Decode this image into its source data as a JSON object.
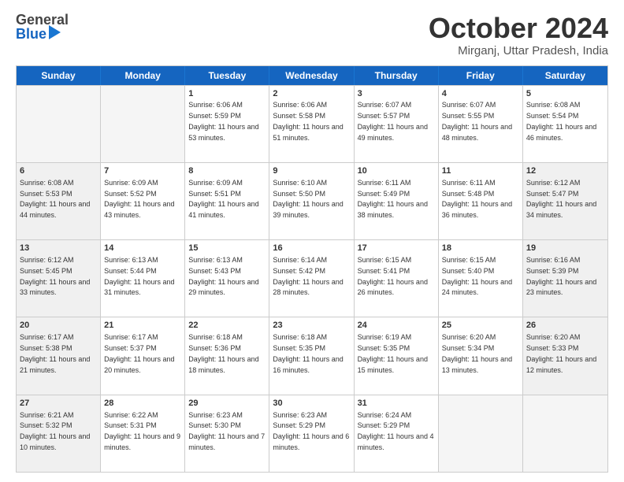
{
  "header": {
    "logo_general": "General",
    "logo_blue": "Blue",
    "title": "October 2024",
    "location": "Mirganj, Uttar Pradesh, India"
  },
  "days_of_week": [
    "Sunday",
    "Monday",
    "Tuesday",
    "Wednesday",
    "Thursday",
    "Friday",
    "Saturday"
  ],
  "weeks": [
    [
      {
        "day": "",
        "sunrise": "",
        "sunset": "",
        "daylight": "",
        "shaded": true
      },
      {
        "day": "",
        "sunrise": "",
        "sunset": "",
        "daylight": "",
        "shaded": true
      },
      {
        "day": "1",
        "sunrise": "Sunrise: 6:06 AM",
        "sunset": "Sunset: 5:59 PM",
        "daylight": "Daylight: 11 hours and 53 minutes.",
        "shaded": false
      },
      {
        "day": "2",
        "sunrise": "Sunrise: 6:06 AM",
        "sunset": "Sunset: 5:58 PM",
        "daylight": "Daylight: 11 hours and 51 minutes.",
        "shaded": false
      },
      {
        "day": "3",
        "sunrise": "Sunrise: 6:07 AM",
        "sunset": "Sunset: 5:57 PM",
        "daylight": "Daylight: 11 hours and 49 minutes.",
        "shaded": false
      },
      {
        "day": "4",
        "sunrise": "Sunrise: 6:07 AM",
        "sunset": "Sunset: 5:55 PM",
        "daylight": "Daylight: 11 hours and 48 minutes.",
        "shaded": false
      },
      {
        "day": "5",
        "sunrise": "Sunrise: 6:08 AM",
        "sunset": "Sunset: 5:54 PM",
        "daylight": "Daylight: 11 hours and 46 minutes.",
        "shaded": false
      }
    ],
    [
      {
        "day": "6",
        "sunrise": "Sunrise: 6:08 AM",
        "sunset": "Sunset: 5:53 PM",
        "daylight": "Daylight: 11 hours and 44 minutes.",
        "shaded": true
      },
      {
        "day": "7",
        "sunrise": "Sunrise: 6:09 AM",
        "sunset": "Sunset: 5:52 PM",
        "daylight": "Daylight: 11 hours and 43 minutes.",
        "shaded": false
      },
      {
        "day": "8",
        "sunrise": "Sunrise: 6:09 AM",
        "sunset": "Sunset: 5:51 PM",
        "daylight": "Daylight: 11 hours and 41 minutes.",
        "shaded": false
      },
      {
        "day": "9",
        "sunrise": "Sunrise: 6:10 AM",
        "sunset": "Sunset: 5:50 PM",
        "daylight": "Daylight: 11 hours and 39 minutes.",
        "shaded": false
      },
      {
        "day": "10",
        "sunrise": "Sunrise: 6:11 AM",
        "sunset": "Sunset: 5:49 PM",
        "daylight": "Daylight: 11 hours and 38 minutes.",
        "shaded": false
      },
      {
        "day": "11",
        "sunrise": "Sunrise: 6:11 AM",
        "sunset": "Sunset: 5:48 PM",
        "daylight": "Daylight: 11 hours and 36 minutes.",
        "shaded": false
      },
      {
        "day": "12",
        "sunrise": "Sunrise: 6:12 AM",
        "sunset": "Sunset: 5:47 PM",
        "daylight": "Daylight: 11 hours and 34 minutes.",
        "shaded": true
      }
    ],
    [
      {
        "day": "13",
        "sunrise": "Sunrise: 6:12 AM",
        "sunset": "Sunset: 5:45 PM",
        "daylight": "Daylight: 11 hours and 33 minutes.",
        "shaded": true
      },
      {
        "day": "14",
        "sunrise": "Sunrise: 6:13 AM",
        "sunset": "Sunset: 5:44 PM",
        "daylight": "Daylight: 11 hours and 31 minutes.",
        "shaded": false
      },
      {
        "day": "15",
        "sunrise": "Sunrise: 6:13 AM",
        "sunset": "Sunset: 5:43 PM",
        "daylight": "Daylight: 11 hours and 29 minutes.",
        "shaded": false
      },
      {
        "day": "16",
        "sunrise": "Sunrise: 6:14 AM",
        "sunset": "Sunset: 5:42 PM",
        "daylight": "Daylight: 11 hours and 28 minutes.",
        "shaded": false
      },
      {
        "day": "17",
        "sunrise": "Sunrise: 6:15 AM",
        "sunset": "Sunset: 5:41 PM",
        "daylight": "Daylight: 11 hours and 26 minutes.",
        "shaded": false
      },
      {
        "day": "18",
        "sunrise": "Sunrise: 6:15 AM",
        "sunset": "Sunset: 5:40 PM",
        "daylight": "Daylight: 11 hours and 24 minutes.",
        "shaded": false
      },
      {
        "day": "19",
        "sunrise": "Sunrise: 6:16 AM",
        "sunset": "Sunset: 5:39 PM",
        "daylight": "Daylight: 11 hours and 23 minutes.",
        "shaded": true
      }
    ],
    [
      {
        "day": "20",
        "sunrise": "Sunrise: 6:17 AM",
        "sunset": "Sunset: 5:38 PM",
        "daylight": "Daylight: 11 hours and 21 minutes.",
        "shaded": true
      },
      {
        "day": "21",
        "sunrise": "Sunrise: 6:17 AM",
        "sunset": "Sunset: 5:37 PM",
        "daylight": "Daylight: 11 hours and 20 minutes.",
        "shaded": false
      },
      {
        "day": "22",
        "sunrise": "Sunrise: 6:18 AM",
        "sunset": "Sunset: 5:36 PM",
        "daylight": "Daylight: 11 hours and 18 minutes.",
        "shaded": false
      },
      {
        "day": "23",
        "sunrise": "Sunrise: 6:18 AM",
        "sunset": "Sunset: 5:35 PM",
        "daylight": "Daylight: 11 hours and 16 minutes.",
        "shaded": false
      },
      {
        "day": "24",
        "sunrise": "Sunrise: 6:19 AM",
        "sunset": "Sunset: 5:35 PM",
        "daylight": "Daylight: 11 hours and 15 minutes.",
        "shaded": false
      },
      {
        "day": "25",
        "sunrise": "Sunrise: 6:20 AM",
        "sunset": "Sunset: 5:34 PM",
        "daylight": "Daylight: 11 hours and 13 minutes.",
        "shaded": false
      },
      {
        "day": "26",
        "sunrise": "Sunrise: 6:20 AM",
        "sunset": "Sunset: 5:33 PM",
        "daylight": "Daylight: 11 hours and 12 minutes.",
        "shaded": true
      }
    ],
    [
      {
        "day": "27",
        "sunrise": "Sunrise: 6:21 AM",
        "sunset": "Sunset: 5:32 PM",
        "daylight": "Daylight: 11 hours and 10 minutes.",
        "shaded": true
      },
      {
        "day": "28",
        "sunrise": "Sunrise: 6:22 AM",
        "sunset": "Sunset: 5:31 PM",
        "daylight": "Daylight: 11 hours and 9 minutes.",
        "shaded": false
      },
      {
        "day": "29",
        "sunrise": "Sunrise: 6:23 AM",
        "sunset": "Sunset: 5:30 PM",
        "daylight": "Daylight: 11 hours and 7 minutes.",
        "shaded": false
      },
      {
        "day": "30",
        "sunrise": "Sunrise: 6:23 AM",
        "sunset": "Sunset: 5:29 PM",
        "daylight": "Daylight: 11 hours and 6 minutes.",
        "shaded": false
      },
      {
        "day": "31",
        "sunrise": "Sunrise: 6:24 AM",
        "sunset": "Sunset: 5:29 PM",
        "daylight": "Daylight: 11 hours and 4 minutes.",
        "shaded": false
      },
      {
        "day": "",
        "sunrise": "",
        "sunset": "",
        "daylight": "",
        "shaded": true
      },
      {
        "day": "",
        "sunrise": "",
        "sunset": "",
        "daylight": "",
        "shaded": true
      }
    ]
  ]
}
